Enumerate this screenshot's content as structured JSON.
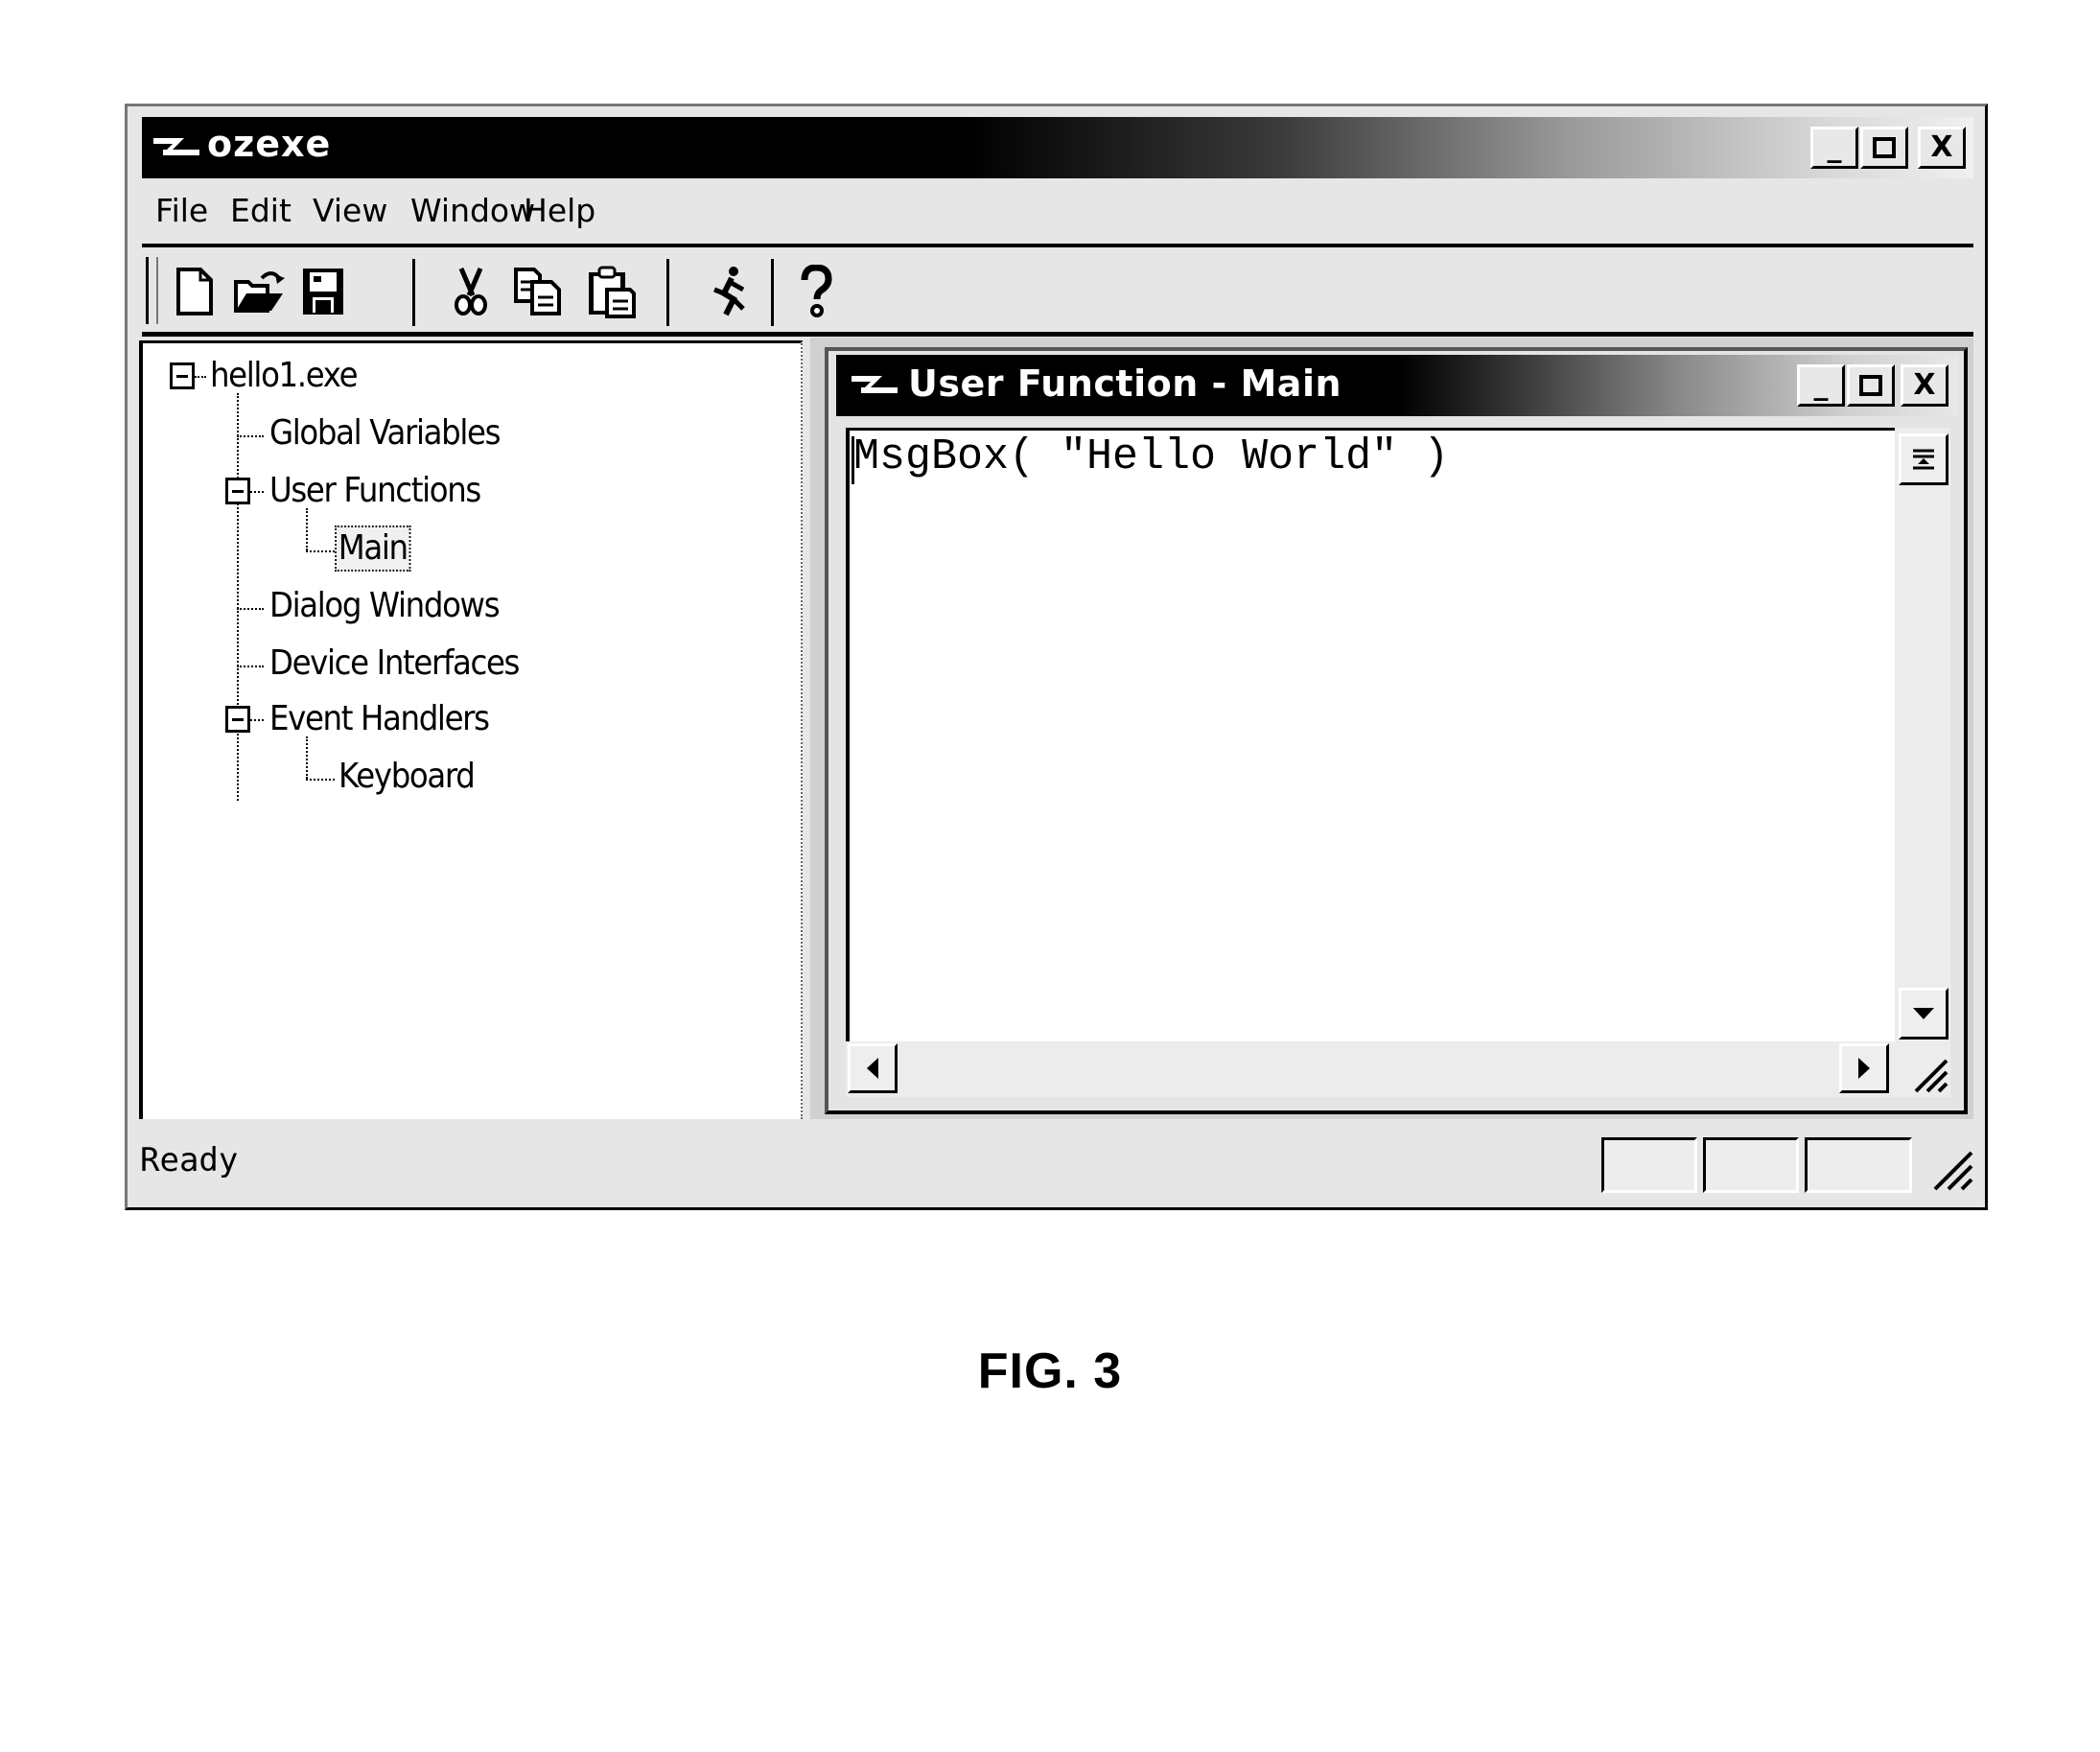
{
  "app": {
    "title": "ozexe",
    "window_controls": {
      "minimize": "_",
      "maximize": "□",
      "close": "X"
    }
  },
  "menu": {
    "items": [
      "File",
      "Edit",
      "View",
      "Window",
      "Help"
    ]
  },
  "toolbar": {
    "buttons": [
      {
        "name": "new",
        "icon": "new-document-icon"
      },
      {
        "name": "open",
        "icon": "open-folder-icon"
      },
      {
        "name": "save",
        "icon": "save-disk-icon"
      },
      {
        "name": "cut",
        "icon": "scissors-icon"
      },
      {
        "name": "copy",
        "icon": "copy-icon"
      },
      {
        "name": "paste",
        "icon": "paste-clipboard-icon"
      },
      {
        "name": "run",
        "icon": "running-figure-icon"
      },
      {
        "name": "help",
        "icon": "help-question-icon"
      }
    ]
  },
  "tree": {
    "root": "hello1.exe",
    "items": [
      {
        "label": "Global Variables",
        "level": 1
      },
      {
        "label": "User Functions",
        "level": 1,
        "expanded": true
      },
      {
        "label": "Main",
        "level": 2,
        "selected": true
      },
      {
        "label": "Dialog Windows",
        "level": 1
      },
      {
        "label": "Device Interfaces",
        "level": 1
      },
      {
        "label": "Event Handlers",
        "level": 1,
        "expanded": true
      },
      {
        "label": "Keyboard",
        "level": 2
      }
    ]
  },
  "editor": {
    "title": "User Function - Main",
    "code": "MsgBox( \"Hello World\" )",
    "window_controls": {
      "minimize": "_",
      "maximize": "□",
      "close": "X"
    }
  },
  "status": {
    "text": "Ready",
    "panels": [
      "",
      "",
      ""
    ]
  },
  "caption": "FIG. 3"
}
